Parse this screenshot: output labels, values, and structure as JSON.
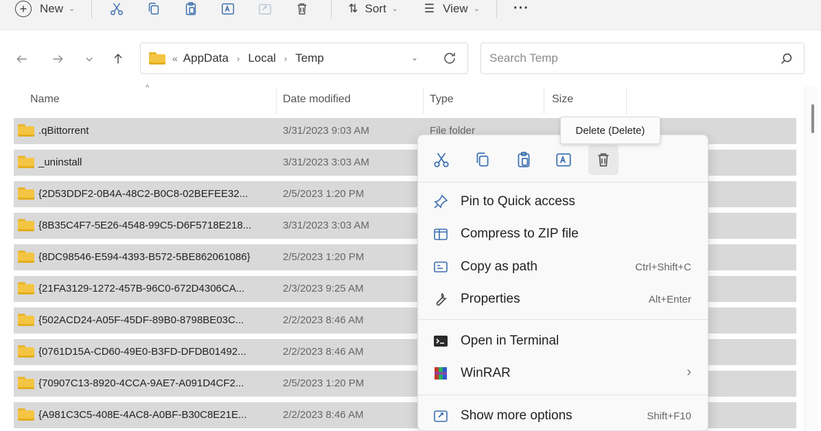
{
  "toolbar": {
    "new_label": "New",
    "sort_label": "Sort",
    "view_label": "View",
    "more_label": "···"
  },
  "address": {
    "overflow": "«",
    "crumbs": [
      "AppData",
      "Local",
      "Temp"
    ]
  },
  "search": {
    "placeholder": "Search Temp"
  },
  "columns": {
    "name": "Name",
    "date": "Date modified",
    "type": "Type",
    "size": "Size"
  },
  "files": [
    {
      "name": ".qBittorrent",
      "date": "3/31/2023 9:03 AM",
      "type": "File folder"
    },
    {
      "name": "_uninstall",
      "date": "3/31/2023 3:03 AM",
      "type": ""
    },
    {
      "name": "{2D53DDF2-0B4A-48C2-B0C8-02BEFEE32...",
      "date": "2/5/2023 1:20 PM",
      "type": ""
    },
    {
      "name": "{8B35C4F7-5E26-4548-99C5-D6F5718E218...",
      "date": "3/31/2023 3:03 AM",
      "type": ""
    },
    {
      "name": "{8DC98546-E594-4393-B572-5BE862061086}",
      "date": "2/5/2023 1:20 PM",
      "type": ""
    },
    {
      "name": "{21FA3129-1272-457B-96C0-672D4306CA...",
      "date": "2/3/2023 9:25 AM",
      "type": ""
    },
    {
      "name": "{502ACD24-A05F-45DF-89B0-8798BE03C...",
      "date": "2/2/2023 8:46 AM",
      "type": ""
    },
    {
      "name": "{0761D15A-CD60-49E0-B3FD-DFDB01492...",
      "date": "2/2/2023 8:46 AM",
      "type": ""
    },
    {
      "name": "{70907C13-8920-4CCA-9AE7-A091D4CF2...",
      "date": "2/5/2023 1:20 PM",
      "type": ""
    },
    {
      "name": "{A981C3C5-408E-4AC8-A0BF-B30C8E21E...",
      "date": "2/2/2023 8:46 AM",
      "type": ""
    }
  ],
  "tooltip": {
    "text": "Delete (Delete)"
  },
  "context_menu": {
    "items": [
      {
        "label": "Pin to Quick access",
        "shortcut": ""
      },
      {
        "label": "Compress to ZIP file",
        "shortcut": ""
      },
      {
        "label": "Copy as path",
        "shortcut": "Ctrl+Shift+C"
      },
      {
        "label": "Properties",
        "shortcut": "Alt+Enter"
      },
      {
        "label": "Open in Terminal",
        "shortcut": ""
      },
      {
        "label": "WinRAR",
        "shortcut": ""
      },
      {
        "label": "Show more options",
        "shortcut": "Shift+F10"
      }
    ]
  },
  "colors": {
    "selection": "#d9d9d9",
    "folder": "#f4c542",
    "menu_bg": "#f9f9f9"
  }
}
